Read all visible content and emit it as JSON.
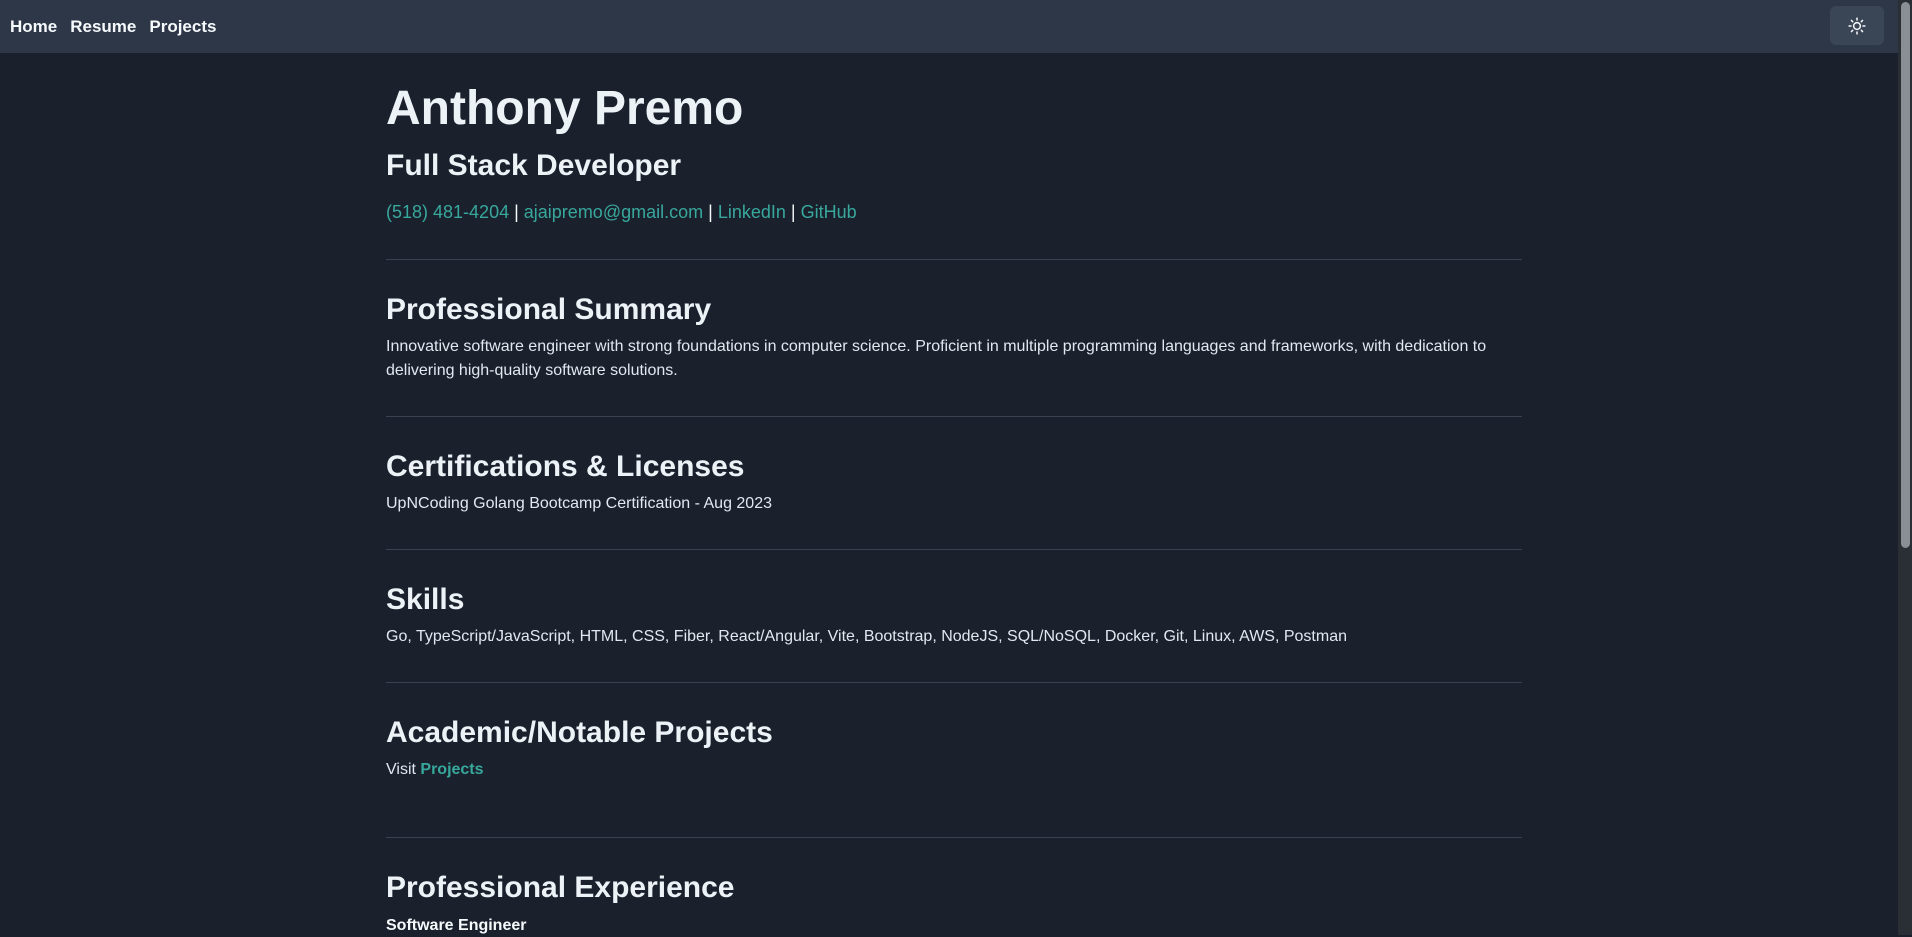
{
  "nav": {
    "home": "Home",
    "resume": "Resume",
    "projects": "Projects",
    "theme_icon": "sun-icon"
  },
  "header": {
    "name": "Anthony Premo",
    "role": "Full Stack Developer",
    "phone": "(518) 481-4204",
    "email": "ajaipremo@gmail.com",
    "linkedin": "LinkedIn",
    "github": "GitHub",
    "separator": " | "
  },
  "summary": {
    "title": "Professional Summary",
    "text": "Innovative software engineer with strong foundations in computer science. Proficient in multiple programming languages and frameworks, with dedication to delivering high-quality software solutions."
  },
  "certifications": {
    "title": "Certifications & Licenses",
    "text": "UpNCoding Golang Bootcamp Certification - Aug 2023"
  },
  "skills": {
    "title": "Skills",
    "text": "Go, TypeScript/JavaScript, HTML, CSS, Fiber, React/Angular, Vite, Bootstrap, NodeJS, SQL/NoSQL, Docker, Git, Linux, AWS, Postman"
  },
  "projects": {
    "title": "Academic/Notable Projects",
    "visit": "Visit",
    "link": "Projects"
  },
  "experience": {
    "title": "Professional Experience",
    "job_title": "Software Engineer"
  },
  "colors": {
    "background": "#1a202c",
    "navbar": "#2d3748",
    "accent": "#38a89d"
  }
}
